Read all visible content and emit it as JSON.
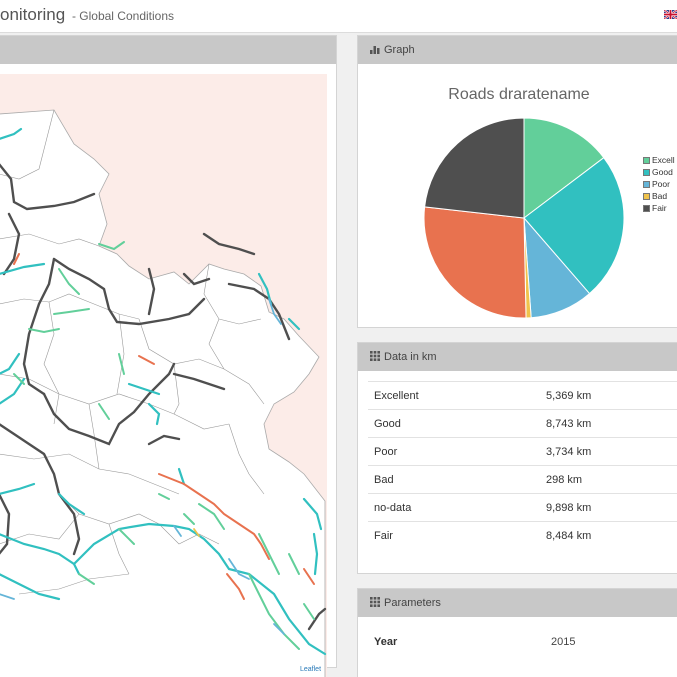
{
  "header": {
    "title": "onitoring",
    "subtitle": "- Global Conditions",
    "language_icon": "uk-flag-icon"
  },
  "map": {
    "attribution": "Leaflet"
  },
  "graph": {
    "header": "Graph",
    "header_icon": "bar-chart-icon"
  },
  "data": {
    "header": "Data in km",
    "header_icon": "grid-icon",
    "rows": [
      {
        "label": "Excellent",
        "value": "5,369 km"
      },
      {
        "label": "Good",
        "value": "8,743 km"
      },
      {
        "label": "Poor",
        "value": "3,734 km"
      },
      {
        "label": "Bad",
        "value": "298 km"
      },
      {
        "label": "no-data",
        "value": "9,898 km"
      },
      {
        "label": "Fair",
        "value": "8,484 km"
      }
    ]
  },
  "parameters": {
    "header": "Parameters",
    "header_icon": "grid-icon",
    "year_label": "Year",
    "year_value": "2015"
  },
  "chart_data": {
    "type": "pie",
    "title": "Roads draratename",
    "legend_position": "right",
    "categories": [
      "Excellent",
      "Good",
      "Poor",
      "Bad",
      "no-data",
      "Fair"
    ],
    "values": [
      5369,
      8743,
      3734,
      298,
      9898,
      8484
    ],
    "colors": [
      "#62cf9a",
      "#31c0c0",
      "#65b5d8",
      "#f0c34c",
      "#e8724f",
      "#4f4f4f"
    ],
    "legend": [
      {
        "label": "Excell",
        "color": "#62cf9a"
      },
      {
        "label": "Good",
        "color": "#31c0c0"
      },
      {
        "label": "Poor",
        "color": "#65b5d8"
      },
      {
        "label": "Bad",
        "color": "#f0c34c"
      },
      {
        "label": "Fair",
        "color": "#4f4f4f"
      }
    ]
  }
}
